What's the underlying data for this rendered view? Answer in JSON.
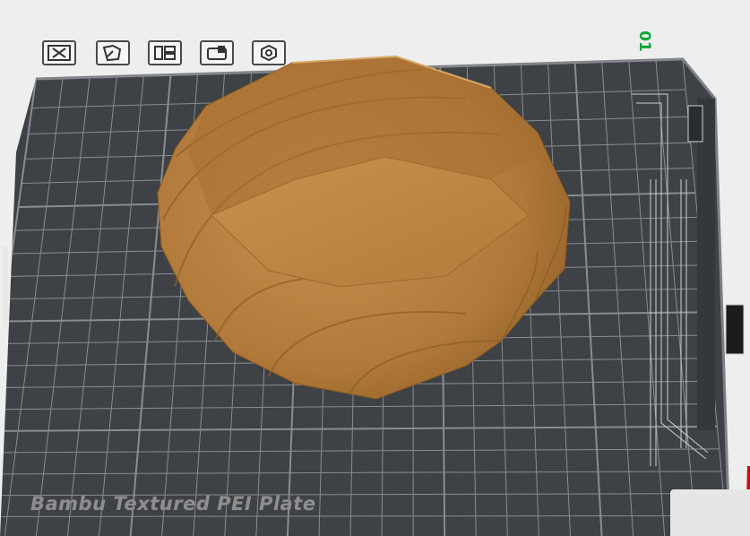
{
  "plate": {
    "label": "Bambu Textured PEI Plate",
    "number": "01",
    "bed_color": "#3e4145",
    "grid_color": "#8a8d90"
  },
  "model": {
    "color": "#c08a45"
  },
  "toolbar": {
    "items": [
      {
        "name": "remove-plate-icon"
      },
      {
        "name": "auto-orient-icon"
      },
      {
        "name": "arrange-icon"
      },
      {
        "name": "lock-plate-icon"
      },
      {
        "name": "plate-settings-icon"
      }
    ]
  }
}
